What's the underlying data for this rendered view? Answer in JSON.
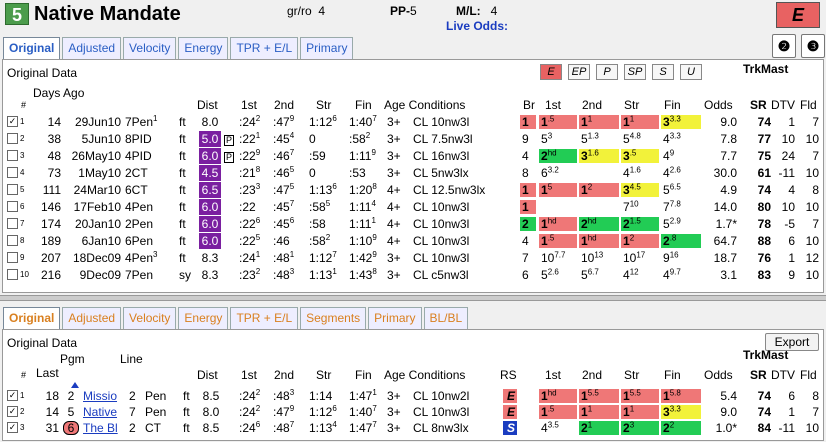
{
  "header": {
    "num": "5",
    "name": "Native Mandate",
    "grro_label": "gr/ro",
    "grro": "4",
    "pp_label": "PP-",
    "pp": "5",
    "ml_label": "M/L:",
    "ml": "4",
    "live_odds": "Live Odds:",
    "e_button": "E",
    "btn2": "❷",
    "btn3": "❸"
  },
  "tabs_top": [
    "Original",
    "Adjusted",
    "Velocity",
    "Energy",
    "TPR + E/L",
    "Primary"
  ],
  "tabs_bottom": [
    "Original",
    "Adjusted",
    "Velocity",
    "Energy",
    "TPR + E/L",
    "Segments",
    "Primary",
    "BL/BL"
  ],
  "top": {
    "section_label": "Original Data",
    "style_buttons": [
      "E",
      "EP",
      "P",
      "SP",
      "S",
      "U"
    ],
    "cols": {
      "num": "#",
      "days": "Days Ago",
      "dist": "Dist",
      "c1": "1st",
      "c2": "2nd",
      "str": "Str",
      "fin": "Fin",
      "agecond": "Age Conditions",
      "br": "Br",
      "b1": "1st",
      "b2": "2nd",
      "bstr": "Str",
      "bfin": "Fin",
      "odds": "Odds",
      "trk": "TrkMast",
      "sr": "SR",
      "dtv": "DTV",
      "fld": "Fld"
    },
    "rows": [
      {
        "chk": "✓",
        "i": "1",
        "days": "14",
        "date": "29Jun10",
        "race": "7Pen",
        "raceSup": "1",
        "surf": "ft",
        "dist": "8.0",
        "purple": false,
        "p": "",
        "c1": "24",
        "c1s": "2",
        "c2": ":47",
        "c2s": "9",
        "str": "1:12",
        "strs": "6",
        "fin": "1:40",
        "fins": "7",
        "age": "3+",
        "cond": "CL 10nw3l",
        "br": "1",
        "brc": "pink",
        "b1": "1",
        "b1s": ".5",
        "b1c": "pink",
        "b2": "1",
        "b2s": "1",
        "b2c": "pink",
        "bs": "1",
        "bss": "1",
        "bsc": "pink",
        "bf": "3",
        "bfs": "3.3",
        "bfc": "yellow",
        "odds": "9.0",
        "sr": "74",
        "dtv": "1",
        "fld": "7"
      },
      {
        "chk": "",
        "i": "2",
        "days": "38",
        "date": "5Jun10",
        "race": "8PID",
        "raceSup": "",
        "surf": "ft",
        "dist": "5.0",
        "purple": true,
        "p": "P",
        "c1": "22",
        "c1s": "1",
        "c2": ":45",
        "c2s": "4",
        "str": "0",
        "strs": "",
        "fin": ":58",
        "fins": "2",
        "age": "3+",
        "cond": "CL 7.5nw3l",
        "br": "9",
        "brc": "",
        "b1": "5",
        "b1s": "3",
        "b1c": "",
        "b2": "5",
        "b2s": "1.3",
        "b2c": "",
        "bs": "5",
        "bss": "4.8",
        "bsc": "",
        "bf": "4",
        "bfs": "3.3",
        "bfc": "",
        "odds": "7.8",
        "sr": "77",
        "dtv": "10",
        "fld": "10"
      },
      {
        "chk": "",
        "i": "3",
        "days": "48",
        "date": "26May10",
        "race": "4PID",
        "raceSup": "",
        "surf": "ft",
        "dist": "6.0",
        "purple": true,
        "p": "P",
        "c1": "22",
        "c1s": "9",
        "c2": ":46",
        "c2s": "7",
        "str": ":59",
        "strs": "",
        "fin": "1:11",
        "fins": "9",
        "age": "3+",
        "cond": "CL 16nw3l",
        "br": "4",
        "brc": "",
        "b1": "2",
        "b1s": "hd",
        "b1c": "green",
        "b2": "3",
        "b2s": "1.6",
        "b2c": "yellow",
        "bs": "3",
        "bss": ".5",
        "bsc": "yellow",
        "bf": "4",
        "bfs": "9",
        "bfc": "",
        "odds": "7.7",
        "sr": "75",
        "dtv": "24",
        "fld": "7"
      },
      {
        "chk": "",
        "i": "4",
        "days": "73",
        "date": "1May10",
        "race": "2CT",
        "raceSup": "",
        "surf": "ft",
        "dist": "4.5",
        "purple": true,
        "p": "",
        "c1": "21",
        "c1s": "8",
        "c2": ":46",
        "c2s": "5",
        "str": "0",
        "strs": "",
        "fin": ":53",
        "fins": "",
        "age": "3+",
        "cond": "CL 5nw3lx",
        "br": "8",
        "brc": "",
        "b1": "6",
        "b1s": "3.2",
        "b1c": "",
        "b2": "",
        "b2s": "",
        "b2c": "",
        "bs": "4",
        "bss": "1.6",
        "bsc": "",
        "bf": "4",
        "bfs": "2.6",
        "bfc": "",
        "odds": "30.0",
        "sr": "61",
        "dtv": "-11",
        "fld": "10"
      },
      {
        "chk": "",
        "i": "5",
        "days": "111",
        "date": "24Mar10",
        "race": "6CT",
        "raceSup": "",
        "surf": "ft",
        "dist": "6.5",
        "purple": true,
        "p": "",
        "c1": "23",
        "c1s": "3",
        "c2": ":47",
        "c2s": "5",
        "str": "1:13",
        "strs": "6",
        "fin": "1:20",
        "fins": "8",
        "age": "4+",
        "cond": "CL 12.5nw3lx",
        "br": "1",
        "brc": "pink",
        "b1": "1",
        "b1s": "5",
        "b1c": "pink",
        "b2": "1",
        "b2s": "2",
        "b2c": "pink",
        "bs": "3",
        "bss": "4.5",
        "bsc": "yellow",
        "bf": "5",
        "bfs": "6.5",
        "bfc": "",
        "odds": "4.9",
        "sr": "74",
        "dtv": "4",
        "fld": "8"
      },
      {
        "chk": "",
        "i": "6",
        "days": "146",
        "date": "17Feb10",
        "race": "4Pen",
        "raceSup": "",
        "surf": "ft",
        "dist": "6.0",
        "purple": true,
        "p": "",
        "c1": "22",
        "c1s": "",
        "c2": ":45",
        "c2s": "7",
        "str": ":58",
        "strs": "5",
        "fin": "1:11",
        "fins": "4",
        "age": "4+",
        "cond": "CL 10nw3l",
        "br": "1",
        "brc": "pink",
        "b1": "",
        "b1s": "",
        "b1c": "",
        "b2": "",
        "b2s": "",
        "b2c": "",
        "bs": "7",
        "bss": "10",
        "bsc": "",
        "bf": "7",
        "bfs": "7.8",
        "bfc": "",
        "odds": "14.0",
        "sr": "80",
        "dtv": "10",
        "fld": "10"
      },
      {
        "chk": "",
        "i": "7",
        "days": "174",
        "date": "20Jan10",
        "race": "2Pen",
        "raceSup": "",
        "surf": "ft",
        "dist": "6.0",
        "purple": true,
        "p": "",
        "c1": "22",
        "c1s": "6",
        "c2": ":45",
        "c2s": "6",
        "str": ":58",
        "strs": "",
        "fin": "1:11",
        "fins": "1",
        "age": "4+",
        "cond": "CL 10nw3l",
        "br": "2",
        "brc": "green",
        "b1": "1",
        "b1s": "hd",
        "b1c": "pink",
        "b2": "2",
        "b2s": "hd",
        "b2c": "green",
        "bs": "2",
        "bss": "1.5",
        "bsc": "green",
        "bf": "5",
        "bfs": "2.9",
        "bfc": "",
        "odds": "1.7*",
        "sr": "78",
        "dtv": "-5",
        "fld": "7"
      },
      {
        "chk": "",
        "i": "8",
        "days": "189",
        "date": "6Jan10",
        "race": "6Pen",
        "raceSup": "",
        "surf": "ft",
        "dist": "6.0",
        "purple": true,
        "p": "",
        "c1": "22",
        "c1s": "5",
        "c2": ":46",
        "c2s": "",
        "str": ":58",
        "strs": "2",
        "fin": "1:10",
        "fins": "9",
        "age": "4+",
        "cond": "CL 10nw3l",
        "br": "4",
        "brc": "",
        "b1": "1",
        "b1s": ".5",
        "b1c": "pink",
        "b2": "1",
        "b2s": "hd",
        "b2c": "pink",
        "bs": "1",
        "bss": "2",
        "bsc": "pink",
        "bf": "2",
        "bfs": ".8",
        "bfc": "green",
        "odds": "64.7",
        "sr": "88",
        "dtv": "6",
        "fld": "10"
      },
      {
        "chk": "",
        "i": "9",
        "days": "207",
        "date": "18Dec09",
        "race": "4Pen",
        "raceSup": "3",
        "surf": "ft",
        "dist": "8.3",
        "purple": false,
        "p": "",
        "c1": "24",
        "c1s": "1",
        "c2": ":48",
        "c2s": "1",
        "str": "1:12",
        "strs": "7",
        "fin": "1:42",
        "fins": "9",
        "age": "3+",
        "cond": "CL 10nw3l",
        "br": "7",
        "brc": "",
        "b1": "10",
        "b1s": "7.7",
        "b1c": "",
        "b2": "10",
        "b2s": "13",
        "b2c": "",
        "bs": "10",
        "bss": "17",
        "bsc": "",
        "bf": "9",
        "bfs": "16",
        "bfc": "",
        "odds": "18.7",
        "sr": "76",
        "dtv": "1",
        "fld": "12"
      },
      {
        "chk": "",
        "i": "10",
        "days": "216",
        "date": "9Dec09",
        "race": "7Pen",
        "raceSup": "",
        "surf": "sy",
        "dist": "8.3",
        "purple": false,
        "p": "",
        "c1": "23",
        "c1s": "2",
        "c2": ":48",
        "c2s": "3",
        "str": "1:13",
        "strs": "1",
        "fin": "1:43",
        "fins": "8",
        "age": "3+",
        "cond": "CL c5nw3l",
        "br": "6",
        "brc": "",
        "b1": "5",
        "b1s": "2.6",
        "b1c": "",
        "b2": "5",
        "b2s": "6.7",
        "b2c": "",
        "bs": "4",
        "bss": "12",
        "bsc": "",
        "bf": "4",
        "bfs": "9.7",
        "bfc": "",
        "odds": "3.1",
        "sr": "83",
        "dtv": "9",
        "fld": "10"
      }
    ]
  },
  "bottom": {
    "section_label": "Original Data",
    "export": "Export",
    "cols": {
      "num": "#",
      "last": "Last",
      "pgm": "Pgm",
      "line": "Line",
      "dist": "Dist",
      "c1": "1st",
      "c2": "2nd",
      "str": "Str",
      "fin": "Fin",
      "agecond": "Age Conditions",
      "rs": "RS",
      "b1": "1st",
      "b2": "2nd",
      "bstr": "Str",
      "bfin": "Fin",
      "odds": "Odds",
      "trk": "TrkMast",
      "sr": "SR",
      "dtv": "DTV",
      "fld": "Fld"
    },
    "rows": [
      {
        "i": "1",
        "last": "18",
        "pgm": "2",
        "name": "Missio",
        "pp": "2",
        "trk": "Pen",
        "surf": "ft",
        "dist": "8.5",
        "c1": "24",
        "c1s": "2",
        "c2": ":48",
        "c2s": "3",
        "str": "1:14",
        "strs": "",
        "fin": "1:47",
        "fins": "1",
        "age": "3+",
        "cond": "CL 10nw2l",
        "rs": "E",
        "b1": "1",
        "b1s": "hd",
        "b1c": "pink",
        "b2": "1",
        "b2s": "5.5",
        "b2c": "pink",
        "bs": "1",
        "bss": "5.5",
        "bsc": "pink",
        "bf": "1",
        "bfs": "5.8",
        "bfc": "pink",
        "odds": "5.4",
        "sr": "74",
        "dtv": "6",
        "fld": "8"
      },
      {
        "i": "2",
        "last": "14",
        "pgm": "5",
        "name": "Native",
        "pp": "7",
        "trk": "Pen",
        "surf": "ft",
        "dist": "8.0",
        "c1": "24",
        "c1s": "2",
        "c2": ":47",
        "c2s": "9",
        "str": "1:12",
        "strs": "6",
        "fin": "1:40",
        "fins": "7",
        "age": "3+",
        "cond": "CL 10nw3l",
        "rs": "E",
        "b1": "1",
        "b1s": ".5",
        "b1c": "pink",
        "b2": "1",
        "b2s": "1",
        "b2c": "pink",
        "bs": "1",
        "bss": "1",
        "bsc": "pink",
        "bf": "3",
        "bfs": "3.3",
        "bfc": "yellow",
        "odds": "9.0",
        "sr": "74",
        "dtv": "1",
        "fld": "7"
      },
      {
        "i": "3",
        "last": "31",
        "pgm": "6",
        "name": "The Bl",
        "pp": "2",
        "trk": "CT",
        "surf": "ft",
        "dist": "8.5",
        "c1": "24",
        "c1s": "6",
        "c2": ":48",
        "c2s": "7",
        "str": "1:13",
        "strs": "4",
        "fin": "1:47",
        "fins": "7",
        "age": "3+",
        "cond": "CL 8nw3lx",
        "rs": "S",
        "b1": "4",
        "b1s": "3.5",
        "b1c": "",
        "b2": "2",
        "b2s": "1",
        "b2c": "green",
        "bs": "2",
        "bss": "3",
        "bsc": "green",
        "bf": "2",
        "bfs": "2",
        "bfc": "green",
        "odds": "1.0*",
        "sr": "84",
        "dtv": "-11",
        "fld": "10"
      }
    ]
  },
  "colors": {
    "pink": "#ef7777",
    "green": "#22cc55",
    "yellow": "#f2f23a",
    "purple": "#7a1fa0",
    "header_green": "#4c9c4c"
  }
}
